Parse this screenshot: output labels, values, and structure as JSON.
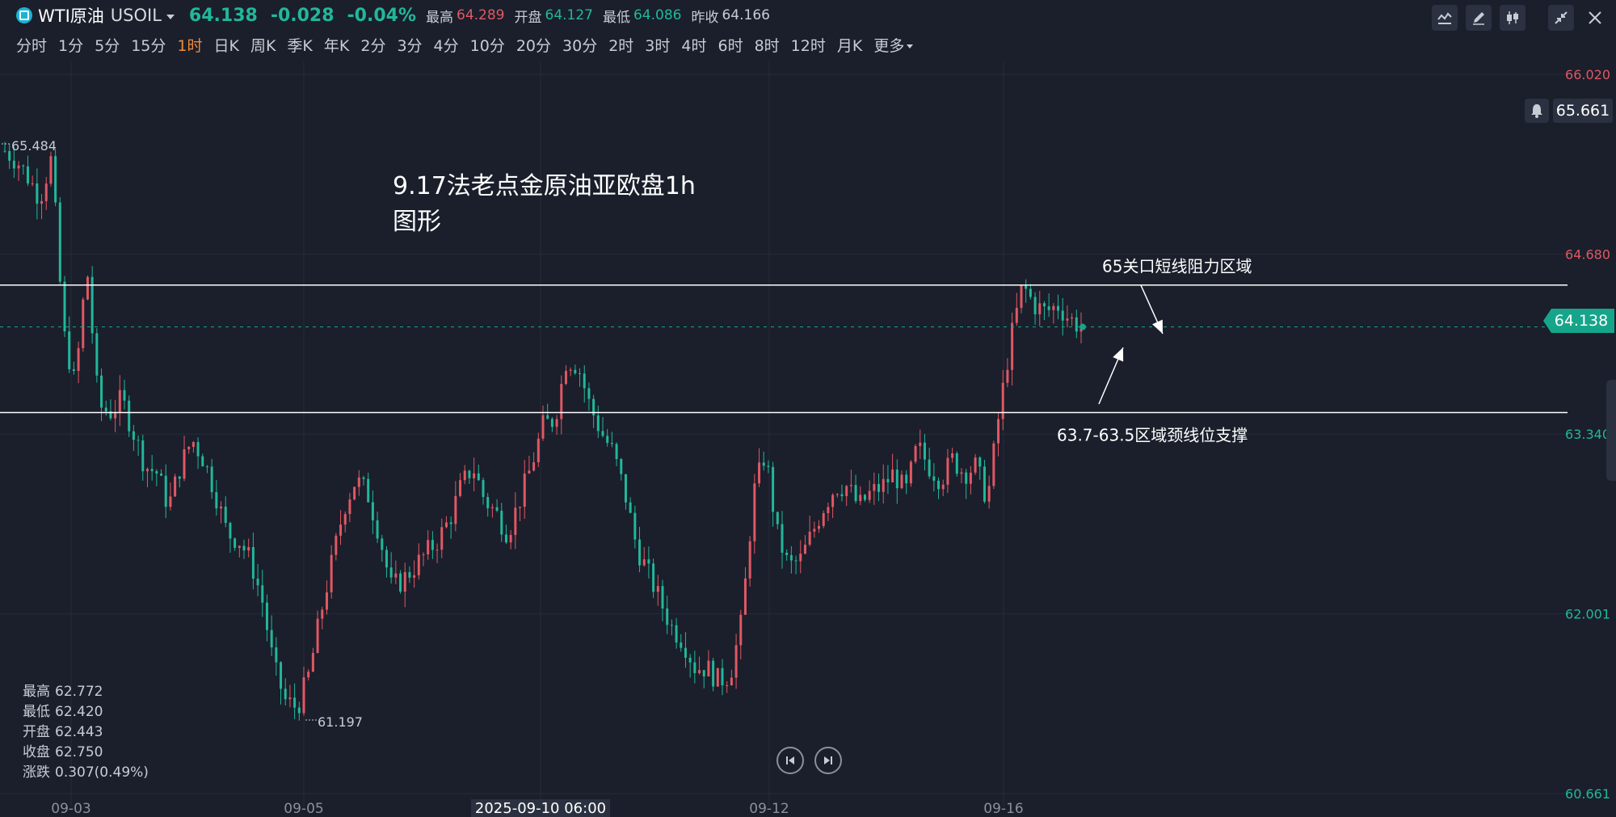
{
  "header": {
    "symbol": "WTI原油",
    "code": "USOIL",
    "price": "64.138",
    "change": "-0.028",
    "change_pct": "-0.04%",
    "stats": [
      {
        "label": "最高",
        "value": "64.289",
        "tone": "up"
      },
      {
        "label": "开盘",
        "value": "64.127",
        "tone": "dn"
      },
      {
        "label": "最低",
        "value": "64.086",
        "tone": "dn"
      },
      {
        "label": "昨收",
        "value": "64.166",
        "tone": "neu"
      }
    ]
  },
  "toolbar_icons": [
    "line-indicator-icon",
    "pen-icon",
    "candle-type-icon",
    "collapse-icon",
    "close-icon"
  ],
  "timeframes": [
    "分时",
    "1分",
    "5分",
    "15分",
    "1时",
    "日K",
    "周K",
    "季K",
    "年K",
    "2分",
    "3分",
    "4分",
    "10分",
    "20分",
    "30分",
    "2时",
    "3时",
    "4时",
    "6时",
    "8时",
    "12时",
    "月K"
  ],
  "active_timeframe": "1时",
  "more_label": "更多",
  "price_box": "65.661",
  "current_price_tag": "64.138",
  "ohlc_panel": [
    {
      "label": "最高",
      "value": "62.772"
    },
    {
      "label": "最低",
      "value": "62.420"
    },
    {
      "label": "开盘",
      "value": "62.443"
    },
    {
      "label": "收盘",
      "value": "62.750"
    },
    {
      "label": "涨跌",
      "value": "0.307(0.49%)"
    }
  ],
  "colors": {
    "up": "#e05864",
    "down": "#22b79a",
    "background": "#1a1f2b",
    "grid": "#252b37",
    "active_tf": "#f08a3c"
  },
  "chart_data": {
    "type": "candlestick",
    "title": "9.17法老点金原油亚欧盘1h图形",
    "ylim": [
      60.661,
      66.02
    ],
    "y_ticks": [
      {
        "value": 66.02,
        "label": "66.020",
        "tone": "up"
      },
      {
        "value": 64.68,
        "label": "64.680",
        "tone": "up"
      },
      {
        "value": 63.34,
        "label": "63.340",
        "tone": "dn"
      },
      {
        "value": 62.001,
        "label": "62.001",
        "tone": "dn"
      },
      {
        "value": 60.661,
        "label": "60.661",
        "tone": "dn"
      }
    ],
    "x_ticks": [
      "09-03",
      "09-05",
      "2025-09-10 06:00",
      "09-12",
      "09-16"
    ],
    "highlighted_x_label": "2025-09-10 06:00",
    "price_path": [
      65.45,
      65.38,
      65.25,
      65.1,
      65.4,
      64.1,
      63.7,
      64.6,
      63.55,
      63.5,
      63.6,
      63.35,
      63.1,
      63.05,
      62.8,
      63.1,
      63.3,
      63.15,
      62.9,
      62.6,
      62.55,
      62.4,
      62.1,
      61.6,
      61.35,
      61.3,
      61.55,
      62.0,
      62.4,
      62.8,
      63.0,
      62.9,
      62.6,
      62.2,
      62.25,
      62.35,
      62.45,
      62.55,
      62.7,
      62.95,
      63.1,
      62.85,
      62.75,
      62.6,
      62.85,
      63.1,
      63.4,
      63.45,
      63.9,
      63.85,
      63.55,
      63.35,
      63.2,
      62.9,
      62.5,
      62.3,
      62.1,
      61.9,
      61.8,
      61.6,
      61.6,
      61.5,
      61.55,
      61.95,
      62.9,
      63.2,
      62.6,
      62.35,
      62.4,
      62.6,
      62.8,
      62.95,
      62.95,
      62.8,
      62.9,
      62.95,
      63.05,
      62.9,
      63.25,
      63.1,
      63.0,
      63.15,
      63.05,
      63.1,
      62.85,
      63.5,
      64.05,
      64.45,
      64.3,
      64.25,
      64.3,
      64.2,
      64.138
    ],
    "last_price": "64.138",
    "max_label": "65.484",
    "min_label": "61.197",
    "lines": [
      {
        "value": 64.45,
        "label": "65关口短线阻力区域"
      },
      {
        "value": 63.5,
        "label": "63.7-63.5区域颈线位支撑"
      }
    ]
  }
}
